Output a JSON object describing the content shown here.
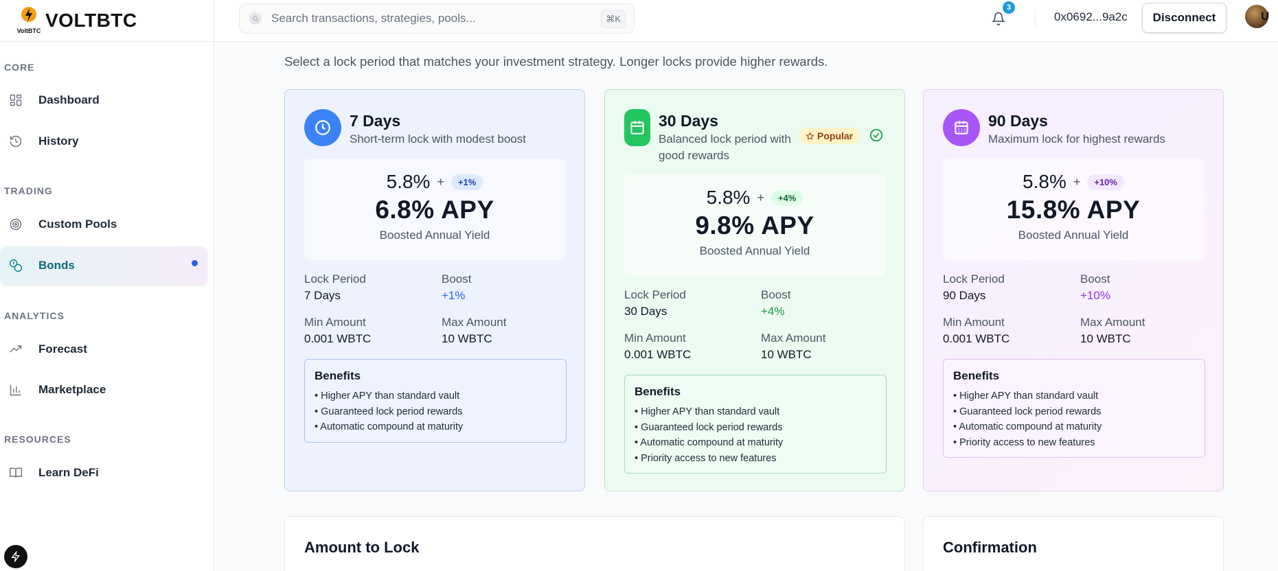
{
  "brand": {
    "name": "VOLTBTC",
    "mark_label": "VoltBTC"
  },
  "sidebar": {
    "sections": [
      {
        "label": "CORE"
      },
      {
        "label": "TRADING"
      },
      {
        "label": "ANALYTICS"
      },
      {
        "label": "RESOURCES"
      }
    ],
    "items": [
      {
        "label": "Dashboard",
        "icon": "grid-icon"
      },
      {
        "label": "History",
        "icon": "history-icon"
      },
      {
        "label": "Custom Pools",
        "icon": "target-icon"
      },
      {
        "label": "Bonds",
        "icon": "bonds-icon",
        "active": true
      },
      {
        "label": "Forecast",
        "icon": "trending-up-icon"
      },
      {
        "label": "Marketplace",
        "icon": "bar-chart-icon"
      },
      {
        "label": "Learn DeFi",
        "icon": "book-icon"
      }
    ]
  },
  "header": {
    "search_placeholder": "Search transactions, strategies, pools...",
    "shortcut": "⌘K",
    "notifications": "3",
    "wallet": "0x0692...9a2c",
    "disconnect_label": "Disconnect",
    "avatar_letter": "U"
  },
  "intro": "Select a lock period that matches your investment strategy. Longer locks provide higher rewards.",
  "plans": [
    {
      "title": "7 Days",
      "subtitle": "Short-term lock with modest boost",
      "base_apy": "5.8%",
      "plus": "+",
      "boost_badge": "+1%",
      "total_apy": "6.8% APY",
      "apy_label": "Boosted Annual Yield",
      "lock_period_label": "Lock Period",
      "lock_period": "7 Days",
      "boost_label": "Boost",
      "boost": "+1%",
      "min_label": "Min Amount",
      "min": "0.001 WBTC",
      "max_label": "Max Amount",
      "max": "10 WBTC",
      "benefits_title": "Benefits",
      "benefits": [
        "• Higher APY than standard vault",
        "• Guaranteed lock period rewards",
        "• Automatic compound at maturity"
      ],
      "color": "#3b82f6"
    },
    {
      "title": "30 Days",
      "subtitle": "Balanced lock period with good rewards",
      "popular": "Popular",
      "base_apy": "5.8%",
      "plus": "+",
      "boost_badge": "+4%",
      "total_apy": "9.8% APY",
      "apy_label": "Boosted Annual Yield",
      "lock_period_label": "Lock Period",
      "lock_period": "30 Days",
      "boost_label": "Boost",
      "boost": "+4%",
      "min_label": "Min Amount",
      "min": "0.001 WBTC",
      "max_label": "Max Amount",
      "max": "10 WBTC",
      "benefits_title": "Benefits",
      "benefits": [
        "• Higher APY than standard vault",
        "• Guaranteed lock period rewards",
        "• Automatic compound at maturity",
        "• Priority access to new features"
      ],
      "color": "#22c55e",
      "selected": true
    },
    {
      "title": "90 Days",
      "subtitle": "Maximum lock for highest rewards",
      "base_apy": "5.8%",
      "plus": "+",
      "boost_badge": "+10%",
      "total_apy": "15.8% APY",
      "apy_label": "Boosted Annual Yield",
      "lock_period_label": "Lock Period",
      "lock_period": "90 Days",
      "boost_label": "Boost",
      "boost": "+10%",
      "min_label": "Min Amount",
      "min": "0.001 WBTC",
      "max_label": "Max Amount",
      "max": "10 WBTC",
      "benefits_title": "Benefits",
      "benefits": [
        "• Higher APY than standard vault",
        "• Guaranteed lock period rewards",
        "• Automatic compound at maturity",
        "• Priority access to new features"
      ],
      "color": "#a855f7"
    }
  ],
  "amount_card": {
    "title": "Amount to Lock"
  },
  "confirm_card": {
    "title": "Confirmation"
  }
}
